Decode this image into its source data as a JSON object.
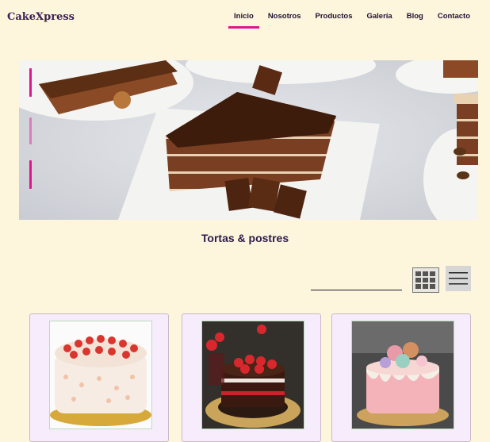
{
  "app": {
    "brand": "CakeXpress"
  },
  "nav": {
    "items": [
      {
        "label": "Inicio",
        "active": true
      },
      {
        "label": "Nosotros",
        "active": false
      },
      {
        "label": "Productos",
        "active": false
      },
      {
        "label": "Galería",
        "active": false
      },
      {
        "label": "Blog",
        "active": false
      },
      {
        "label": "Contacto",
        "active": false
      }
    ]
  },
  "hero": {
    "slide_indicators": 3,
    "image": "chocolate-cake-slice"
  },
  "section": {
    "title": "Tortas & postres"
  },
  "search": {
    "placeholder": "",
    "value": ""
  },
  "view": {
    "grid_icon": "grid-icon",
    "list_icon": "list-icon"
  },
  "products": [
    {
      "image": "strawberry-cream-cake"
    },
    {
      "image": "chocolate-strawberry-cake"
    },
    {
      "image": "pink-macaron-drip-cake"
    }
  ],
  "colors": {
    "background": "#fdf5dc",
    "accent": "#e0158e",
    "card": "#f7ecfb"
  }
}
